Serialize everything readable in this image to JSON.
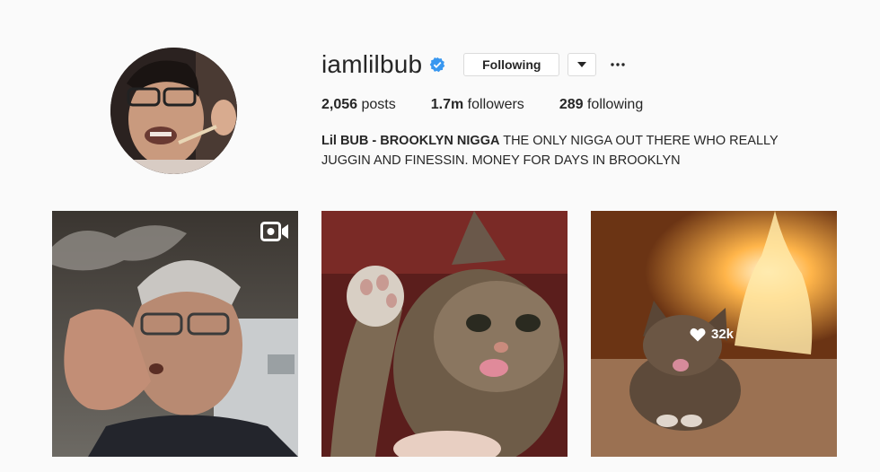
{
  "profile": {
    "username": "iamlilbub",
    "follow_label": "Following",
    "stats": {
      "posts_value": "2,056",
      "posts_label": "posts",
      "followers_value": "1.7m",
      "followers_label": "followers",
      "following_value": "289",
      "following_label": "following"
    },
    "bio": {
      "name": "Lil BUB - BROOKLYN NIGGA",
      "text": " THE ONLY NIGGA OUT THERE WHO REALLY JUGGIN AND FINESSIN. MONEY FOR DAYS IN BROOKLYN"
    }
  },
  "posts": [
    {
      "kind": "video",
      "icon": "video-camera-icon"
    },
    {
      "kind": "photo"
    },
    {
      "kind": "photo",
      "likes": "32k",
      "icon": "heart-icon"
    }
  ],
  "colors": {
    "verified": "#3897f0",
    "border": "#dbdbdb",
    "text": "#262626",
    "background": "#fafafa"
  }
}
